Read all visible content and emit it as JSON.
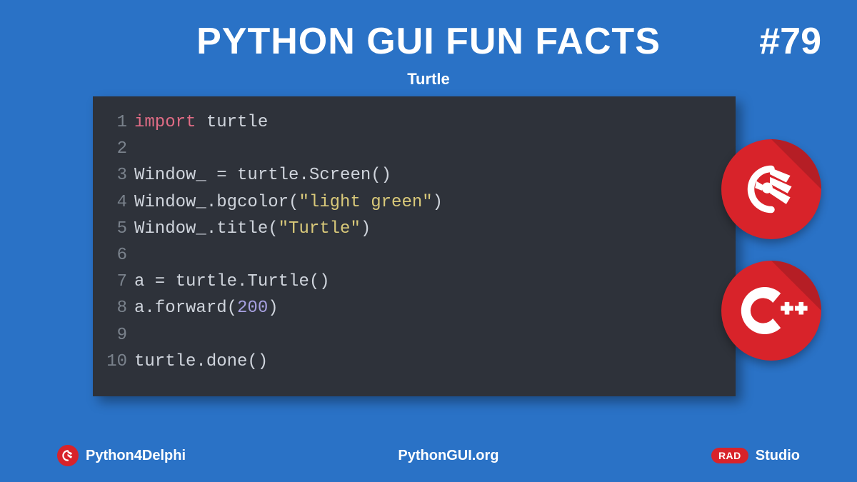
{
  "header": {
    "title": "PYTHON GUI FUN FACTS",
    "number": "#79",
    "subtitle": "Turtle"
  },
  "code": {
    "lines": [
      {
        "num": "1",
        "tokens": [
          {
            "t": "import",
            "c": "kw"
          },
          {
            "t": " turtle",
            "c": "pl"
          }
        ]
      },
      {
        "num": "2",
        "tokens": []
      },
      {
        "num": "3",
        "tokens": [
          {
            "t": "Window_ = turtle.Screen()",
            "c": "pl"
          }
        ]
      },
      {
        "num": "4",
        "tokens": [
          {
            "t": "Window_.bgcolor(",
            "c": "pl"
          },
          {
            "t": "\"light green\"",
            "c": "str"
          },
          {
            "t": ")",
            "c": "pl"
          }
        ]
      },
      {
        "num": "5",
        "tokens": [
          {
            "t": "Window_.title(",
            "c": "pl"
          },
          {
            "t": "\"Turtle\"",
            "c": "str"
          },
          {
            "t": ")",
            "c": "pl"
          }
        ]
      },
      {
        "num": "6",
        "tokens": []
      },
      {
        "num": "7",
        "tokens": [
          {
            "t": "a = turtle.Turtle()",
            "c": "pl"
          }
        ]
      },
      {
        "num": "8",
        "tokens": [
          {
            "t": "a.forward(",
            "c": "pl"
          },
          {
            "t": "200",
            "c": "num"
          },
          {
            "t": ")",
            "c": "pl"
          }
        ]
      },
      {
        "num": "9",
        "tokens": []
      },
      {
        "num": "10",
        "tokens": [
          {
            "t": "turtle.done()",
            "c": "pl"
          }
        ]
      }
    ]
  },
  "footer": {
    "left": "Python4Delphi",
    "center": "PythonGUI.org",
    "right_badge": "RAD",
    "right_text": "Studio"
  },
  "icons": {
    "delphi": "delphi-helmet-icon",
    "cpp": "cpp-builder-icon"
  }
}
